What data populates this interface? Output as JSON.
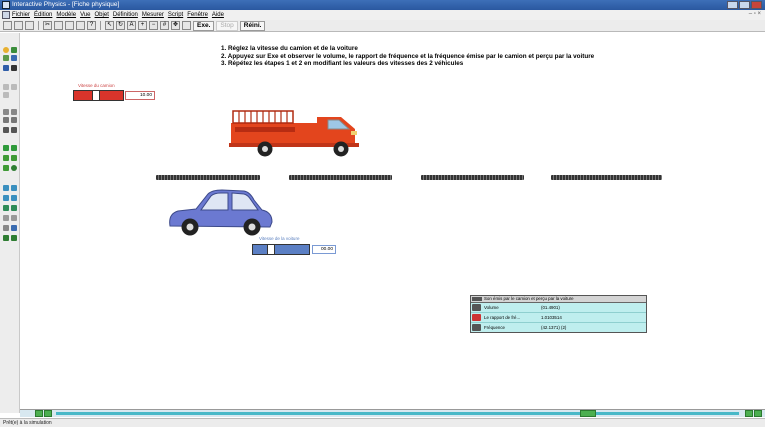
{
  "window": {
    "title": "Interactive Physics - [Fiche physique]"
  },
  "menu": [
    "Fichier",
    "Édition",
    "Modèle",
    "Vue",
    "Objet",
    "Définition",
    "Mesurer",
    "Script",
    "Fenêtre",
    "Aide"
  ],
  "toolbar": {
    "run_label": "Exe.",
    "stop_label": "Stop",
    "reset_label": "Réini."
  },
  "instructions": {
    "line1": "1. Réglez la vitesse du camion et de la voiture",
    "line2": "2. Appuyez sur Exe et observer le volume, le rapport de fréquence et la fréquence émise par le camion et perçu par la voiture",
    "line3": "3. Répétez les étapes 1 et 2 en modifiant les valeurs des vitesses des 2 véhicules"
  },
  "truck_slider": {
    "label": "Vitesse du camion",
    "value": "10.00",
    "level": 0.43,
    "color": "#d9342b"
  },
  "car_slider": {
    "label": "Vitesse de la voiture",
    "value": "00.00",
    "level": 0.3,
    "color": "#5b7fc4"
  },
  "panel": {
    "title": "Son émis par le camion et perçu par la voiture",
    "rows": [
      {
        "label": "Volume",
        "value": "(01.4901)"
      },
      {
        "label": "Le rapport de fré...",
        "value": "1.0103514"
      },
      {
        "label": "Fréquence",
        "value": "(42.1371) (2)"
      }
    ]
  },
  "status": {
    "text": "Prêt(e) à la simulation"
  },
  "colors": {
    "truck": "#e3451d",
    "car": "#6b79d1",
    "panel_bg": "#bfeeee"
  }
}
